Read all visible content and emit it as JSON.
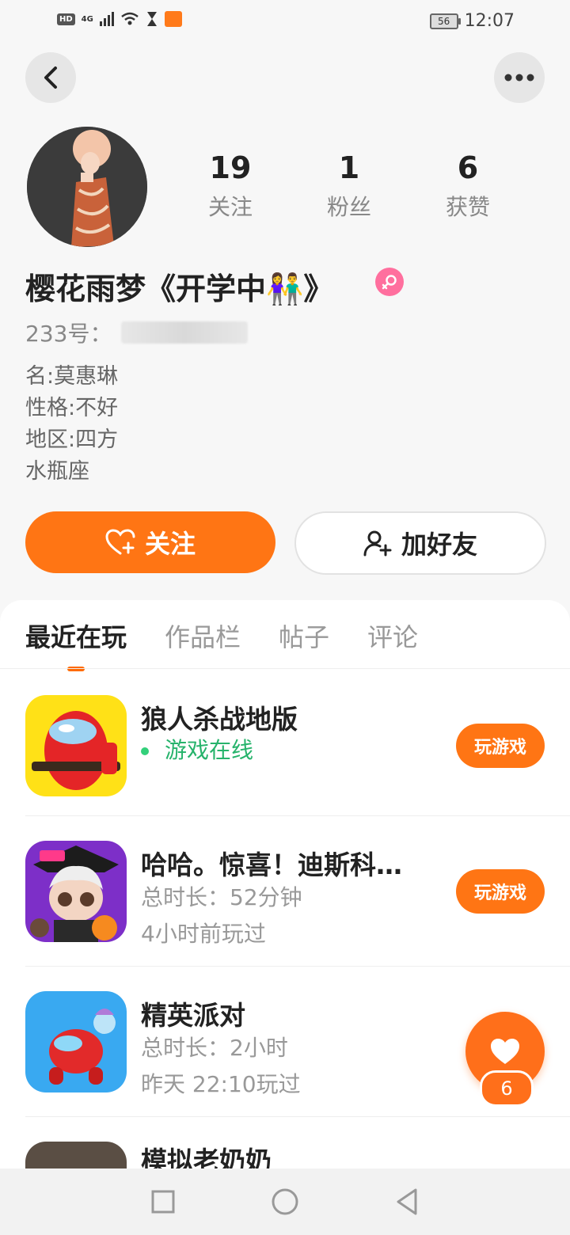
{
  "status_bar": {
    "network": "4G",
    "hd": "HD",
    "battery": "56",
    "time": "12:07"
  },
  "profile": {
    "name": "樱花雨梦《开学中👫》",
    "uid_label": "233号：",
    "bio": [
      "名:莫惠琳",
      "性格:不好",
      "地区:四方",
      "水瓶座"
    ],
    "stats": [
      {
        "value": "19",
        "label": "关注"
      },
      {
        "value": "1",
        "label": "粉丝"
      },
      {
        "value": "6",
        "label": "获赞"
      }
    ]
  },
  "actions": {
    "follow": "关注",
    "add_friend": "加好友"
  },
  "tabs": [
    "最近在玩",
    "作品栏",
    "帖子",
    "评论"
  ],
  "games": [
    {
      "title": "狼人杀战地版",
      "line1": "游戏在线",
      "line2": "",
      "button": "玩游戏"
    },
    {
      "title": "哈哈。惊喜！迪斯科…",
      "line1": "总时长：52分钟",
      "line2": "4小时前玩过",
      "button": "玩游戏"
    },
    {
      "title": "精英派对",
      "line1": "总时长：2小时",
      "line2": "昨天 22:10玩过",
      "button": ""
    },
    {
      "title": "模拟老奶奶",
      "line1": "",
      "line2": "",
      "button": ""
    }
  ],
  "likes": {
    "count": "6"
  }
}
